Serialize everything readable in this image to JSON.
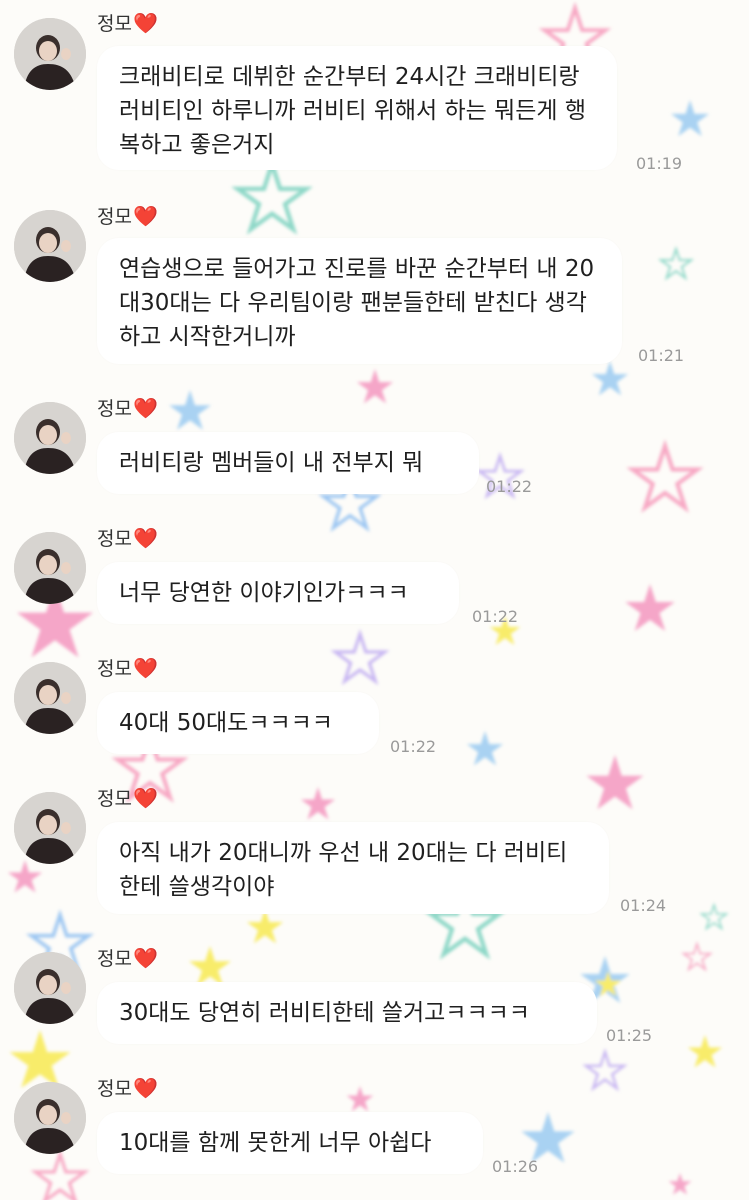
{
  "sender": {
    "name": "정모",
    "name_emoji": "❤️"
  },
  "messages": [
    {
      "text": "크래비티로 데뷔한 순간부터 24시간 크래비티랑 러비티인 하루니까 러비티 위해서 하는 뭐든게 행복하고 좋은거지",
      "time": "01:19"
    },
    {
      "text": "연습생으로 들어가고 진로를 바꾼 순간부터 내 20대30대는 다 우리팀이랑 팬분들한테 받친다 생각하고 시작한거니까",
      "time": "01:21"
    },
    {
      "text": "러비티랑 멤버들이 내 전부지 뭐",
      "time": "01:22"
    },
    {
      "text": "너무 당연한 이야기인가ㅋㅋㅋ",
      "time": "01:22"
    },
    {
      "text": "40대 50대도ㅋㅋㅋㅋ",
      "time": "01:22"
    },
    {
      "text": "아직 내가 20대니까 우선 내 20대는 다 러비티한테 쓸생각이야",
      "time": "01:24"
    },
    {
      "text": "30대도 당연히 러비티한테 쓸거고ㅋㅋㅋㅋ",
      "time": "01:25"
    },
    {
      "text": "10대를 함께 못한게 너무 아쉽다",
      "time": "01:26"
    }
  ],
  "colors": {
    "bubble": "#ffffff",
    "background": "#fdfcf9",
    "heart": "#e0202c",
    "time": "#9a9a9a"
  }
}
